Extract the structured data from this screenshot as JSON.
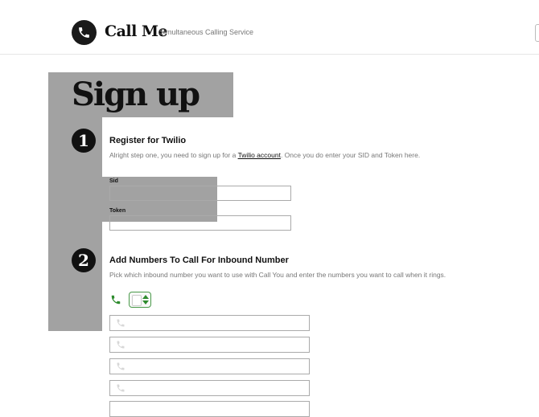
{
  "header": {
    "app_title": "Call Me",
    "tagline": "Simultaneous Calling Service",
    "logo_icon": "phone-icon"
  },
  "page": {
    "title": "Sign up"
  },
  "steps": [
    {
      "number": "1",
      "title": "Register for Twilio",
      "description_before": "Alright step one, you need to sign up for a ",
      "link_text": "Twilio account",
      "description_after": ". Once you do enter your SID and Token here.",
      "fields": [
        {
          "label": "Sid",
          "value": ""
        },
        {
          "label": "Token",
          "value": ""
        }
      ]
    },
    {
      "number": "2",
      "title": "Add Numbers To Call For Inbound Number",
      "description": "Pick which inbound number you want to use with Call You and enter the numbers you want to call when it rings.",
      "inbound_select": {
        "selected": "",
        "icon": "phone-icon"
      },
      "numbers": [
        "",
        "",
        "",
        "",
        ""
      ]
    }
  ],
  "colors": {
    "overlay_gray": "#a2a2a2",
    "accent_green": "#2e8b2e",
    "dark": "#111111"
  }
}
